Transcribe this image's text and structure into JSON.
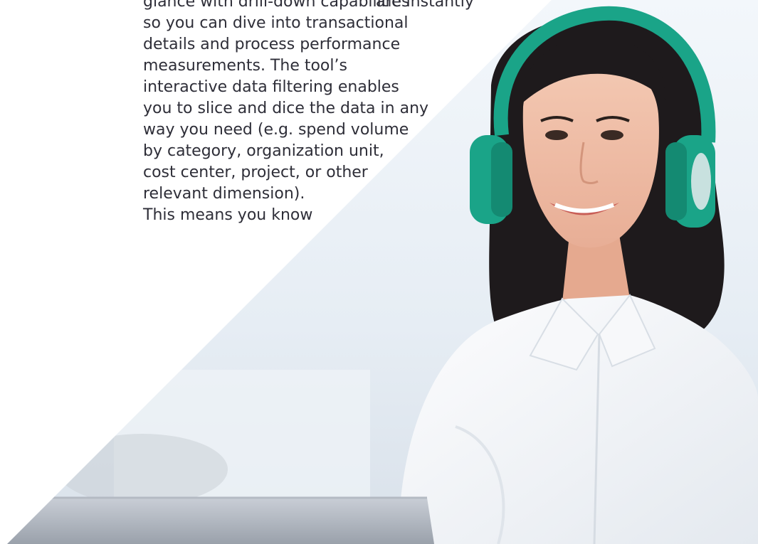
{
  "text_columns": {
    "left_fragments": [
      ",",
      "",
      "",
      "t"
    ],
    "main_lines": [
      "glance with drill-down capabilities",
      "so you can dive into transactional",
      "details and process performance",
      "measurements. The tool’s",
      "interactive data filtering enables",
      "you to slice and dice the data in any",
      "way you need (e.g. spend volume",
      "by category, organization unit,",
      "cost center, project, or other",
      "relevant dimension).",
      "This means you know"
    ],
    "right_lines": [
      "are instantly"
    ]
  },
  "photo": {
    "subject": "woman wearing headphones",
    "headphone_color": "#1aa488",
    "icon": "person-photo"
  },
  "colors": {
    "text": "#2e2e38",
    "background": "#ffffff",
    "headphones": "#1aa488"
  }
}
